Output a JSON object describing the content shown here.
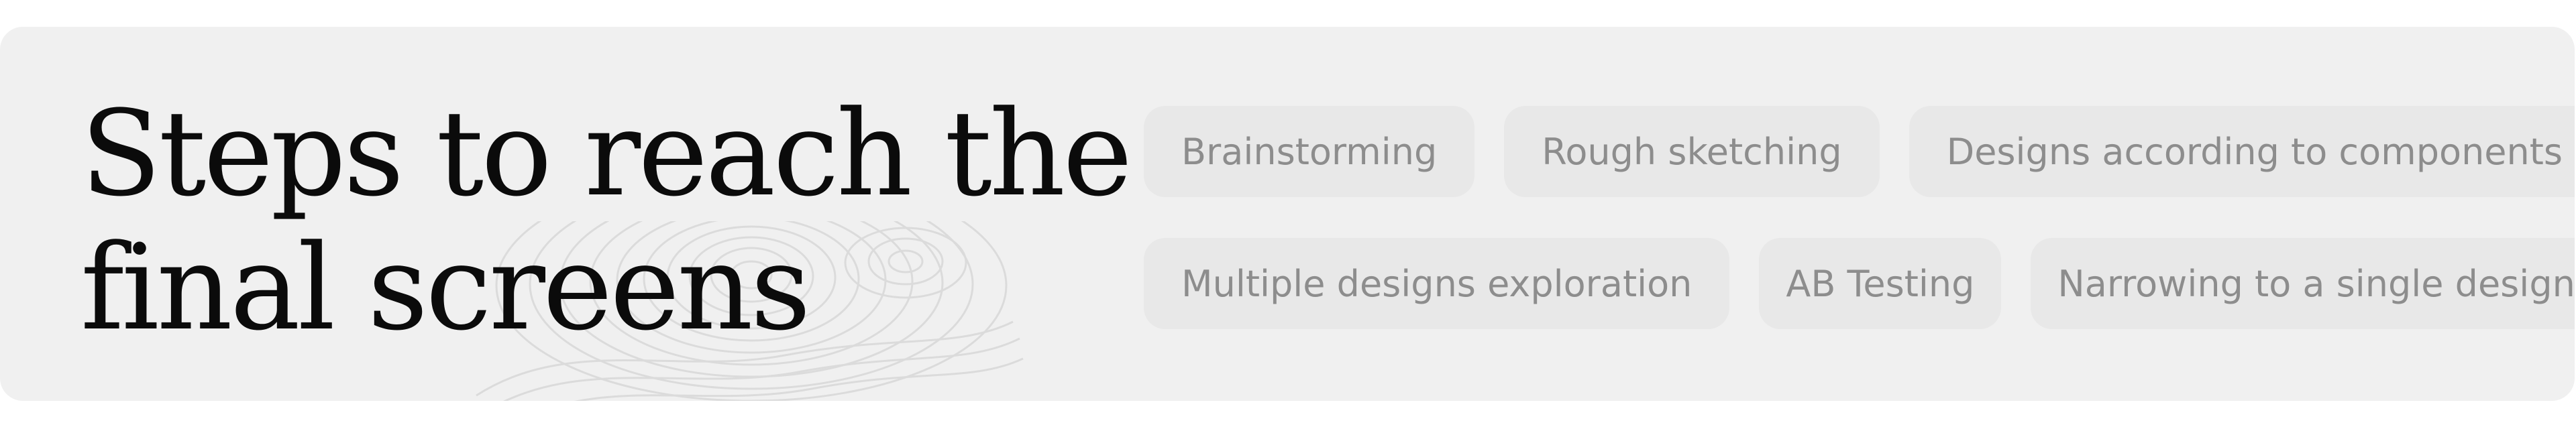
{
  "heading": {
    "line1": "Steps to reach the",
    "line2": "final screens"
  },
  "steps": {
    "row1": [
      "Brainstorming",
      "Rough sketching",
      "Designs according to components"
    ],
    "row2": [
      "Multiple designs exploration",
      "AB Testing",
      "Narrowing to a single design"
    ]
  },
  "colors": {
    "card_background": "#f0f0f0",
    "chip_background": "#e8e8e8",
    "chip_text": "#8d8d8d",
    "heading_text": "#0b0b0b"
  }
}
